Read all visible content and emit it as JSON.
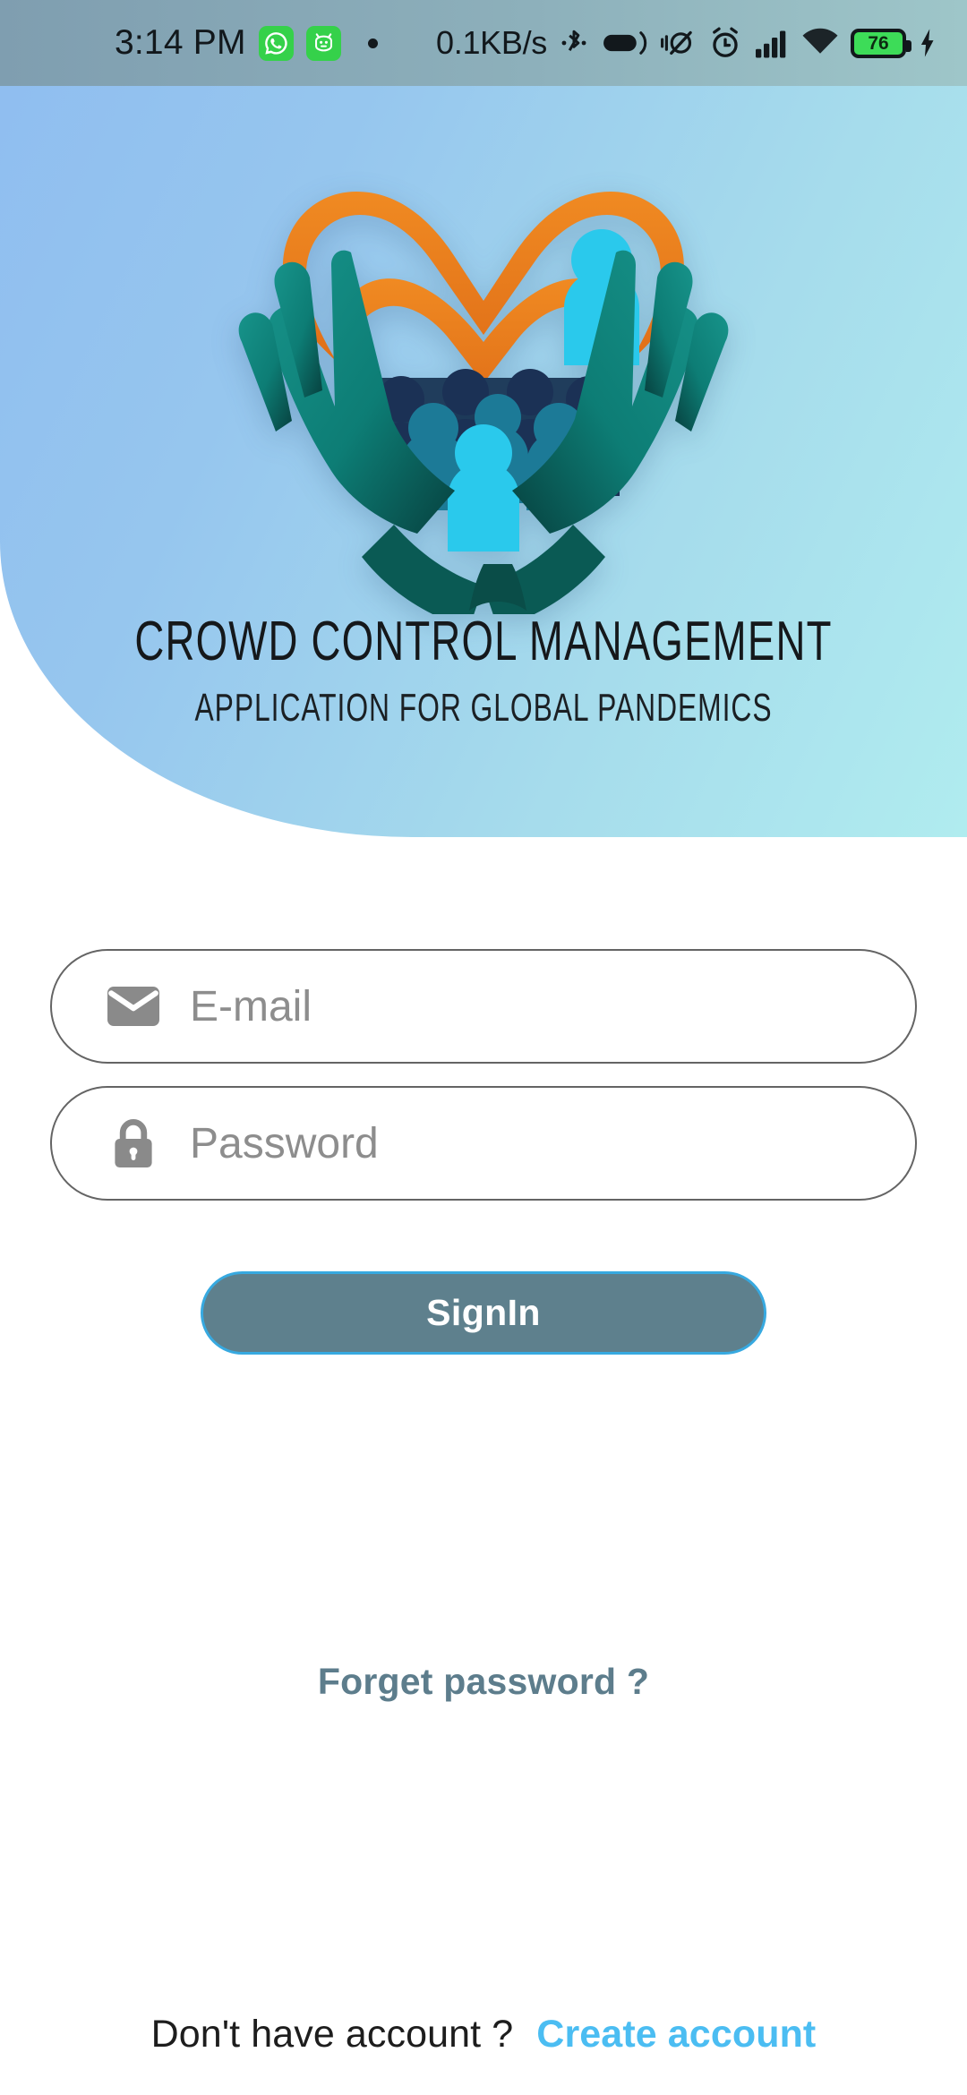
{
  "status_bar": {
    "time": "3:14 PM",
    "network_speed": "0.1KB/s",
    "battery_percent": "76",
    "icons": [
      "whatsapp-icon",
      "green-app-icon",
      "notification-dot-icon",
      "bluetooth-icon",
      "capsule-icon",
      "vibrate-off-icon",
      "alarm-icon",
      "signal-bars-icon",
      "wifi-icon",
      "battery-icon",
      "charging-bolt-icon"
    ],
    "background_color": "#8db0bb"
  },
  "header": {
    "title": "CROWD CONTROL MANAGEMENT",
    "subtitle": "APPLICATION FOR GLOBAL PANDEMICS",
    "logo_name": "crowd-control-logo",
    "gradient_start": "#8fbdf0",
    "gradient_end": "#b0ecef",
    "logo_colors": {
      "heart": "#ef7f22",
      "hands": "#0f7f78",
      "hands_dark": "#0b5650",
      "people_dark": "#1d3458",
      "people_cyan": "#28c8ea",
      "people_teal": "#1b7f9e"
    }
  },
  "form": {
    "email": {
      "placeholder": "E-mail",
      "value": "",
      "icon": "envelope-icon"
    },
    "password": {
      "placeholder": "Password",
      "value": "",
      "icon": "lock-icon"
    },
    "signin_label": "SignIn",
    "signin_fill": "#5e808d",
    "signin_border": "#37a9e0",
    "forget_password_label": "Forget password ?",
    "forget_password_color": "#5d7d8c"
  },
  "footer": {
    "prompt": "Don't have account ?",
    "create_account_label": "Create account",
    "create_account_color": "#4bbdf2"
  }
}
